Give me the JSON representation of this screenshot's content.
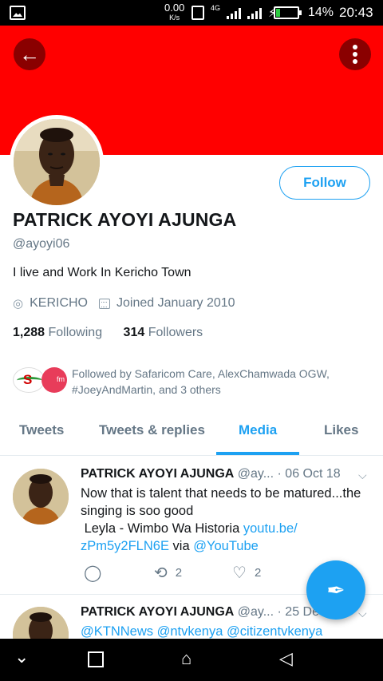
{
  "status_bar": {
    "speed_value": "0.00",
    "speed_unit": "K/s",
    "network": "4G",
    "battery_pct": "14%",
    "battery_level": 0.14,
    "time": "20:43"
  },
  "header": {
    "back_icon": "arrow-left-icon",
    "more_icon": "more-vertical-icon",
    "banner_color": "#ff0000"
  },
  "profile": {
    "name": "PATRICK AYOYI AJUNGA",
    "handle": "@ayoyi06",
    "bio": "I live and Work In Kericho Town",
    "location": "KERICHO",
    "joined": "Joined January 2010",
    "following_count": "1,288",
    "following_label": "Following",
    "followers_count": "314",
    "followers_label": "Followers",
    "follow_button": "Follow",
    "followed_by_line1": "Followed by Safaricom Care, AlexChamwada OGW,",
    "followed_by_line2": "#JoeyAndMartin, and 3 others",
    "logo2_text": "fm",
    "logo1_text": "S"
  },
  "tabs": [
    {
      "label": "Tweets",
      "active": false
    },
    {
      "label": "Tweets & replies",
      "active": false
    },
    {
      "label": "Media",
      "active": true
    },
    {
      "label": "Likes",
      "active": false
    }
  ],
  "tweets": [
    {
      "name": "PATRICK AYOYI AJUNGA",
      "handle": "@ay...",
      "date": "· 06 Oct 18",
      "text_line1": "Now that is talent that needs to be matured...the",
      "text_line2": "singing is soo good",
      "text_line3": " Leyla - Wimbo Wa Historia ",
      "link1": "youtu.be/",
      "link1b": "zPm5y2FLN6E",
      "via": " via ",
      "link2": "@YouTube",
      "retweets": "2",
      "likes": "2"
    },
    {
      "name": "PATRICK AYOYI AJUNGA",
      "handle": "@ay...",
      "date": "· 25 De",
      "mentions": "@KTNNews @ntvkenya @citizentvkenya"
    }
  ],
  "compose_icon": "compose-tweet-icon",
  "accent_color": "#1da1f2"
}
